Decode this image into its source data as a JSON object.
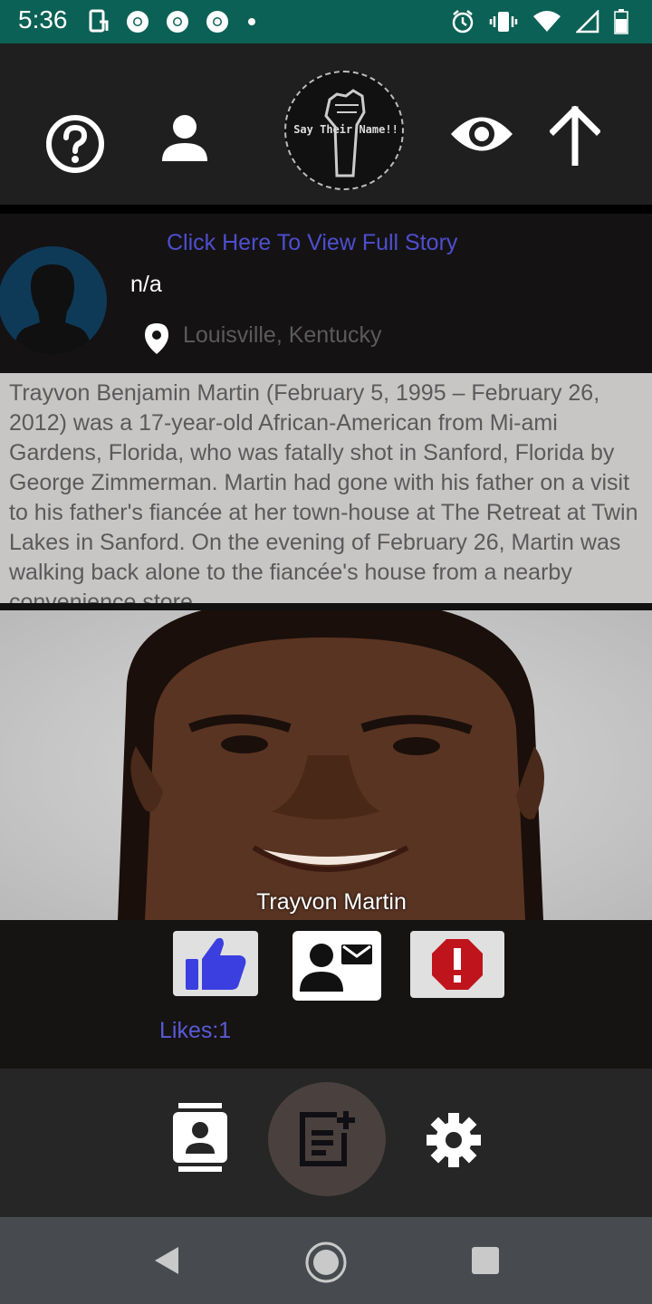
{
  "status_bar": {
    "time": "5:36",
    "left_icons": [
      "screen-rotate-icon",
      "chrome-icon",
      "chrome-icon",
      "chrome-icon",
      "notification-dot-icon"
    ],
    "right_icons": [
      "alarm-icon",
      "vibrate-icon",
      "wifi-icon",
      "cell-signal-icon",
      "battery-icon"
    ]
  },
  "toolbar": {
    "icons": [
      "help-icon",
      "person-icon",
      "eye-icon",
      "arrow-up-icon"
    ],
    "logo_text": "Say Their Name!!"
  },
  "story": {
    "full_story_link": "Click Here To View Full Story",
    "nickname": "n/a",
    "location": "Louisville, Kentucky",
    "bio": "Trayvon Benjamin Martin (February 5, 1995 – February 26, 2012) was a 17-year-old African-American from Mi-ami Gardens, Florida, who was fatally shot in Sanford, Florida by George Zimmerman. Martin had gone with his father on a visit to his father's fiancée at her town-house at The Retreat at Twin Lakes in Sanford. On the evening of February 26, Martin was walking back alone to the fiancée's house from a nearby convenience store",
    "photo_caption": "Trayvon Martin"
  },
  "actions": {
    "likes_label": "Likes:1",
    "like_count": 1,
    "icons": [
      "thumbs-up-icon",
      "contact-mail-icon",
      "alert-icon"
    ]
  },
  "bottom_nav": {
    "icons": [
      "contacts-icon",
      "post-add-icon",
      "settings-icon"
    ]
  },
  "system_nav": {
    "icons": [
      "back-icon",
      "home-icon",
      "recents-icon"
    ]
  },
  "colors": {
    "status_bar": "#0b6155",
    "link": "#4d4fcf",
    "likes": "#5a5ad6",
    "thumb": "#3b3fe0",
    "alert": "#c0141c",
    "bio_bg": "#c8c5c5"
  }
}
